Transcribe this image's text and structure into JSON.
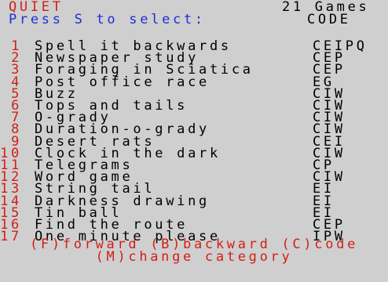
{
  "header": {
    "category": "QUIET",
    "games_count": "21 Games",
    "prompt": "Press S to select:",
    "code_header": "CODE"
  },
  "games": [
    {
      "number": "1",
      "name": "Spell it backwards",
      "code": "CEIPQ"
    },
    {
      "number": "2",
      "name": "Newspaper study",
      "code": "CEP"
    },
    {
      "number": "3",
      "name": "Foraging in Sciatica",
      "code": "CEP"
    },
    {
      "number": "4",
      "name": "Post office race",
      "code": "EG"
    },
    {
      "number": "5",
      "name": "Buzz",
      "code": "CIW"
    },
    {
      "number": "6",
      "name": "Tops and tails",
      "code": "CIW"
    },
    {
      "number": "7",
      "name": "O-grady",
      "code": "CIW"
    },
    {
      "number": "8",
      "name": "Duration-o-grady",
      "code": "CIW"
    },
    {
      "number": "9",
      "name": "Desert rats",
      "code": "CEI"
    },
    {
      "number": "10",
      "name": "Clock in the dark",
      "code": "CIW"
    },
    {
      "number": "11",
      "name": "Telegrams",
      "code": "CP"
    },
    {
      "number": "12",
      "name": "Word game",
      "code": "CIW"
    },
    {
      "number": "13",
      "name": "String tail",
      "code": "EI"
    },
    {
      "number": "14",
      "name": "Darkness drawing",
      "code": "EI"
    },
    {
      "number": "15",
      "name": "Tin ball",
      "code": "EI"
    },
    {
      "number": "16",
      "name": "Find the route",
      "code": "CEP"
    },
    {
      "number": "17",
      "name": "One minute please",
      "code": "IPW"
    }
  ],
  "footer": {
    "line1": "(F)forward (B)backward (C)code",
    "line2": "(M)change category"
  },
  "colors": {
    "background": "#cfcfcf",
    "red": "#d21f15",
    "blue": "#1f2fd5",
    "black": "#000000"
  }
}
